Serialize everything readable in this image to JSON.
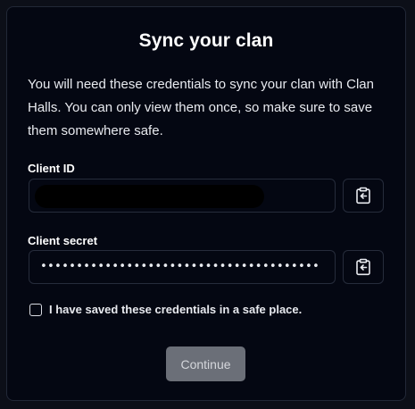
{
  "dialog": {
    "title": "Sync your clan",
    "description": "You will need these credentials to sync your clan with Clan Halls. You can only view them once, so make sure to save them somewhere safe."
  },
  "client_id": {
    "label": "Client ID",
    "value_redacted": true,
    "copy_icon": "clipboard-copy-icon"
  },
  "client_secret": {
    "label": "Client secret",
    "masked_value": "•••••••••••••••••••••••••••••••••••••••",
    "copy_icon": "clipboard-copy-icon"
  },
  "confirmation": {
    "label": "I have saved these credentials in a safe place.",
    "checked": false
  },
  "continue_button": {
    "label": "Continue",
    "disabled": true
  }
}
